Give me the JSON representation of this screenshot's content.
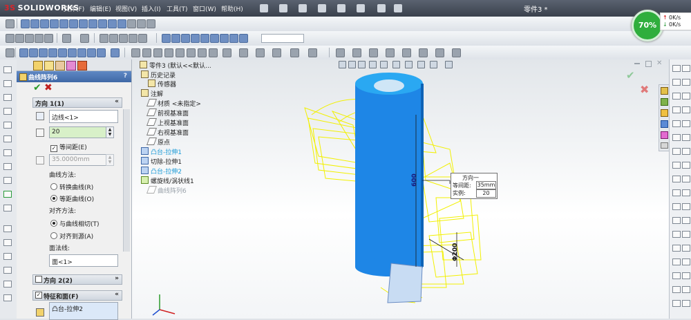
{
  "app": {
    "logo": "SOLIDWORKS",
    "doc_title": "零件3 *"
  },
  "menu": [
    "文件(F)",
    "编辑(E)",
    "视图(V)",
    "插入(I)",
    "工具(T)",
    "窗口(W)",
    "帮助(H)"
  ],
  "gauge": {
    "percent": "70%",
    "up_label": "0K/s",
    "down_label": "0K/s"
  },
  "pm": {
    "tab_icons": [
      "feature-manager-icon",
      "property-manager-icon",
      "configuration-icon",
      "dimxpert-icon",
      "display-icon"
    ],
    "title": "曲线阵列6",
    "help": "?",
    "ok": "✔",
    "cancel": "✖",
    "dir1": {
      "title": "方向 1(1)",
      "edge_value": "边线<1>",
      "count": "20",
      "equal_spacing_label": "等间距(E)",
      "spacing_value": "35.0000mm",
      "curve_method_label": "曲线方法:",
      "curve_opt1": "转换曲线(R)",
      "curve_opt2": "等距曲线(O)",
      "align_label": "对齐方法:",
      "align_opt1": "与曲线相切(T)",
      "align_opt2": "对齐到源(A)",
      "face_normal_label": "面法线:",
      "face_value": "面<1>"
    },
    "dir2": {
      "title": "方向 2(2)"
    },
    "features": {
      "title": "特征和面(F)",
      "item": "凸台-拉伸2"
    }
  },
  "tree": {
    "root": "零件3 (默认<<默认...",
    "items": [
      {
        "label": "历史记录",
        "style": "normal"
      },
      {
        "label": "传感器",
        "style": "normal"
      },
      {
        "label": "注解",
        "style": "normal"
      },
      {
        "label": "材质 <未指定>",
        "style": "normal"
      },
      {
        "label": "前视基准面",
        "style": "normal"
      },
      {
        "label": "上视基准面",
        "style": "normal"
      },
      {
        "label": "右视基准面",
        "style": "normal"
      },
      {
        "label": "原点",
        "style": "normal"
      },
      {
        "label": "凸台-拉伸1",
        "style": "blue"
      },
      {
        "label": "切除-拉伸1",
        "style": "normal"
      },
      {
        "label": "凸台-拉伸2",
        "style": "blue"
      },
      {
        "label": "螺旋线/涡状线1",
        "style": "normal"
      },
      {
        "label": "曲线阵列6",
        "style": "gray"
      }
    ]
  },
  "callout": {
    "title": "方向一",
    "spacing_label": "等间距:",
    "spacing_value": "35mm",
    "count_label": "实例:",
    "count_value": "20"
  },
  "dims": {
    "height": "600",
    "diameter": "Φ200"
  },
  "colors": {
    "model": "#1e86e6",
    "preview": "#f2f000",
    "header": "#4a74b4"
  }
}
